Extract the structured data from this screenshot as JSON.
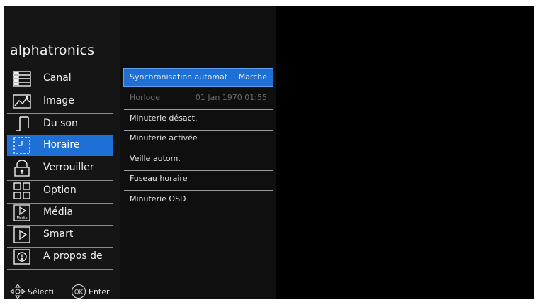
{
  "brand": "alphatronics",
  "menu": [
    {
      "label": "Canal",
      "icon": "list-icon",
      "active": false
    },
    {
      "label": "Image",
      "icon": "picture-icon",
      "active": false
    },
    {
      "label": "Du son",
      "icon": "music-note-icon",
      "active": false
    },
    {
      "label": "Horaire",
      "icon": "clock-icon",
      "active": true
    },
    {
      "label": "Verrouiller",
      "icon": "lock-icon",
      "active": false
    },
    {
      "label": "Option",
      "icon": "grid-icon",
      "active": false
    },
    {
      "label": "Média",
      "icon": "media-icon",
      "active": false
    },
    {
      "label": "Smart",
      "icon": "play-icon",
      "active": false
    },
    {
      "label": "A propos de",
      "icon": "info-icon",
      "active": false
    }
  ],
  "media_icon_text": "Media",
  "submenu": [
    {
      "name": "Synchronisation automat",
      "value": "Marche",
      "active": true,
      "disabled": false
    },
    {
      "name": "Horloge",
      "value": "01 Jan 1970  01:55",
      "active": false,
      "disabled": true
    },
    {
      "name": "Minuterie désact.",
      "value": "",
      "active": false,
      "disabled": false
    },
    {
      "name": "Minuterie activée",
      "value": "",
      "active": false,
      "disabled": false
    },
    {
      "name": "Veille autom.",
      "value": "",
      "active": false,
      "disabled": false
    },
    {
      "name": "Fuseau horaire",
      "value": "",
      "active": false,
      "disabled": false
    },
    {
      "name": "Minuterie OSD",
      "value": "",
      "active": false,
      "disabled": false
    }
  ],
  "footer": {
    "select_label": "Sélecti",
    "ok_glyph": "OK",
    "enter_label": "Enter"
  },
  "colors": {
    "accent": "#1e6fd6",
    "background": "#000000",
    "panel": "#151515",
    "disabled_text": "#6a6a6a"
  }
}
